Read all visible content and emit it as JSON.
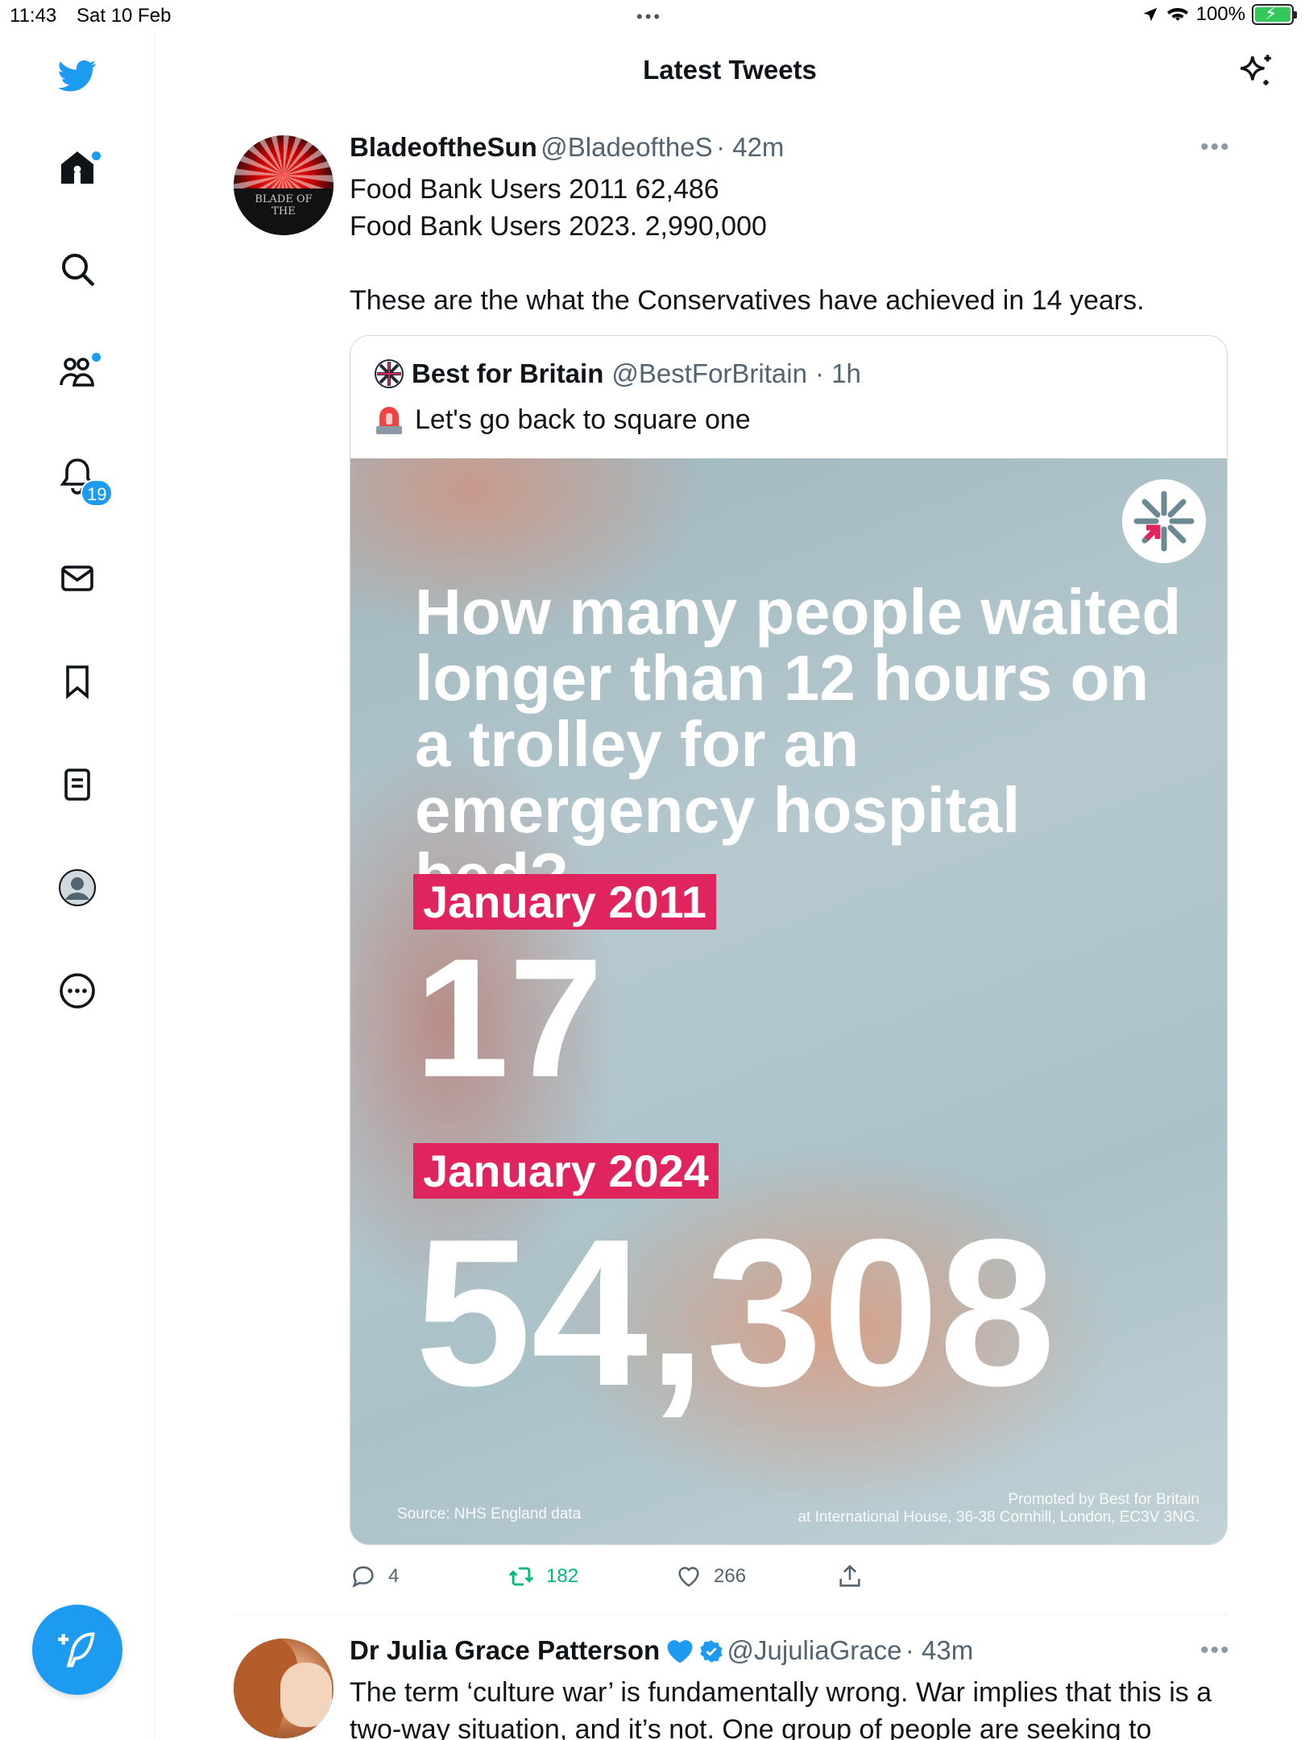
{
  "status_bar": {
    "time": "11:43",
    "date": "Sat 10 Feb",
    "battery": "100%"
  },
  "header": {
    "title": "Latest Tweets"
  },
  "sidebar": {
    "notifications_count": "19"
  },
  "tweets": [
    {
      "name": "BladeoftheSun",
      "handle": "@BladeoftheS",
      "time": "· 42m",
      "text": "Food Bank Users 2011 62,486\nFood Bank Users 2023. 2,990,000\n\nThese are the what the Conservatives have achieved in 14 years.",
      "avatar_text": "BLADE OF THE",
      "quote": {
        "name": "Best for Britain",
        "handle": "@BestForBritain",
        "time": "· 1h",
        "text": "Let's go back to square one",
        "media": {
          "headline": "How many people waited longer than 12 hours on a trolley for an emergency hospital bed?",
          "label_1": "January 2011",
          "value_1": "17",
          "label_2": "January 2024",
          "value_2": "54,308",
          "source": "Source: NHS England data",
          "promo_line1": "Promoted by Best for Britain",
          "promo_line2": "at International House, 36-38 Cornhill, London, EC3V 3NG."
        }
      },
      "actions": {
        "replies": "4",
        "retweets": "182",
        "likes": "266"
      }
    },
    {
      "name": "Dr Julia Grace Patterson",
      "handle": "@JujuliaGrace",
      "time": "· 43m",
      "text": "The term ‘culture war’ is fundamentally wrong. War implies that this is a two-way situation, and it’s not. One group of people are seeking to"
    }
  ],
  "colors": {
    "accent": "#1d9bf0",
    "retweet_green": "#00ba7c",
    "tag_red": "#e0245e"
  }
}
